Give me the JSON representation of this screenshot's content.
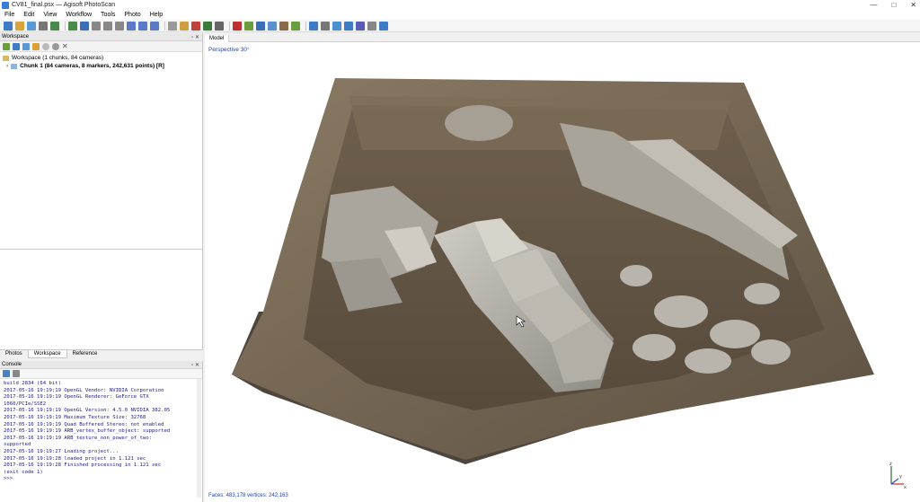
{
  "window": {
    "title": "CV81_final.psx — Agisoft PhotoScan",
    "controls": [
      "—",
      "□",
      "✕"
    ]
  },
  "menu": [
    "File",
    "Edit",
    "View",
    "Workflow",
    "Tools",
    "Photo",
    "Help"
  ],
  "toolbar_icons": [
    "new-icon",
    "open-icon",
    "save-icon",
    "print-icon",
    "undo-icon",
    "redo-icon",
    "select-icon",
    "rect-select-icon",
    "circle-select-icon",
    "free-select-icon",
    "move-icon",
    "rotate-icon",
    "scale-icon",
    "reset-icon",
    "ruler-icon",
    "marker-icon",
    "shape-icon",
    "crop-icon",
    "delete-icon",
    "grid-icon",
    "points-icon",
    "dense-icon",
    "mesh-icon",
    "texture-icon",
    "tiled-icon",
    "camera-icon",
    "show-icon",
    "flag-icon",
    "markers-icon",
    "regions-icon",
    "navigate-icon"
  ],
  "workspace": {
    "header": "Workspace",
    "root": "Workspace (1 chunks, 84 cameras)",
    "chunk": "Chunk 1 (84 cameras, 8 markers, 242,631 points) [R]"
  },
  "tabs": [
    {
      "label": "Photos",
      "active": false
    },
    {
      "label": "Workspace",
      "active": true
    },
    {
      "label": "Reference",
      "active": false
    }
  ],
  "console": {
    "header": "Console",
    "lines": [
      "build 2834 (64 bit)",
      "2017-05-16 19:19:19 OpenGL Vendor: NVIDIA Corporation",
      "2017-05-16 19:19:19 OpenGL Renderer: GeForce GTX",
      "1060/PCIe/SSE2",
      "2017-05-16 19:19:19 OpenGL Version: 4.5.0 NVIDIA 382.05",
      "2017-05-16 19:19:19 Maximum Texture Size: 32768",
      "2017-05-16 19:19:19 Quad Buffered Stereo: not enabled",
      "2017-05-16 19:19:19 ARB_vertex_buffer_object: supported",
      "2017-05-16 19:19:19 ARB_texture_non_power_of_two:",
      "supported",
      "2017-05-16 19:19:27 Loading project...",
      "2017-05-16 19:19:28 loaded project in 1.121 sec",
      "2017-05-16 19:19:28 Finished processing in 1.121 sec",
      "(exit code 1)",
      ">>>"
    ]
  },
  "model": {
    "tab": "Model",
    "perspective": "Perspective 30°",
    "status": "Faces: 483,178 vertices: 242,163",
    "axis_labels": [
      "z",
      "y",
      "x"
    ]
  },
  "colors": {
    "accent": "#1f3fa8",
    "panel": "#f0f0f0",
    "soil": "#7a6a55",
    "stone": "#b5b2ab"
  }
}
